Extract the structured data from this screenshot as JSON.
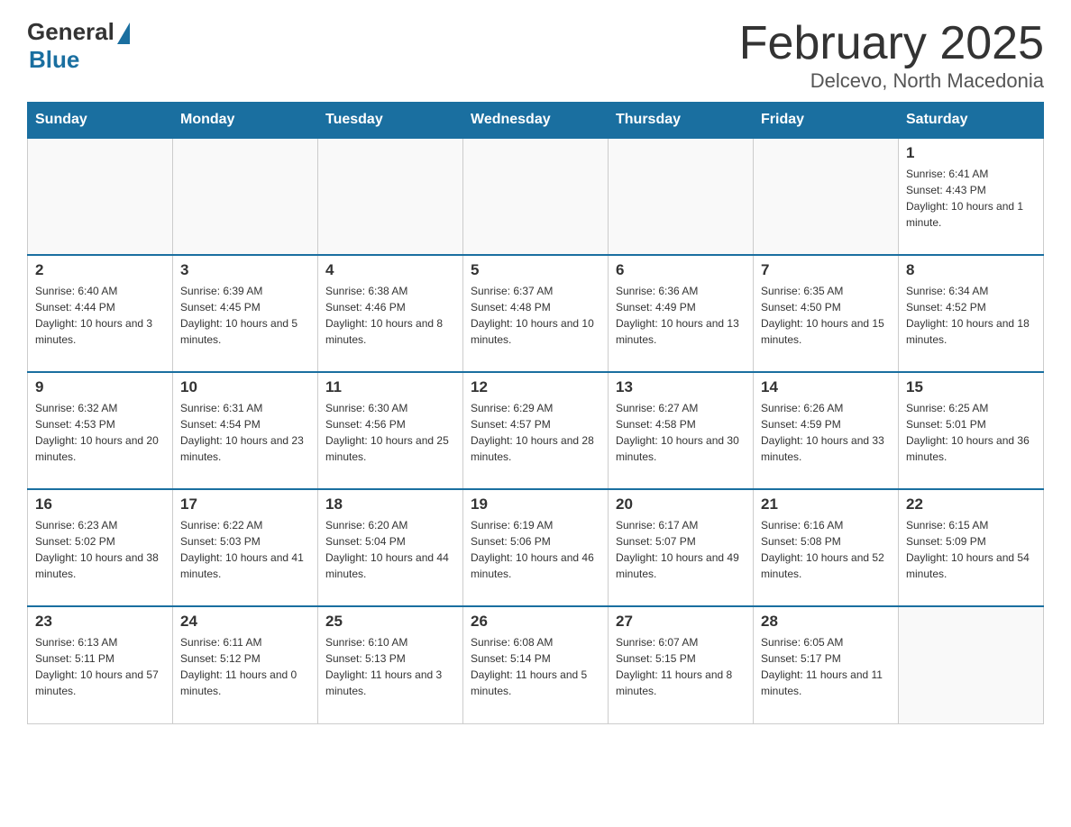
{
  "logo": {
    "general": "General",
    "blue": "Blue"
  },
  "header": {
    "month": "February 2025",
    "location": "Delcevo, North Macedonia"
  },
  "weekdays": [
    "Sunday",
    "Monday",
    "Tuesday",
    "Wednesday",
    "Thursday",
    "Friday",
    "Saturday"
  ],
  "weeks": [
    [
      {
        "day": "",
        "info": ""
      },
      {
        "day": "",
        "info": ""
      },
      {
        "day": "",
        "info": ""
      },
      {
        "day": "",
        "info": ""
      },
      {
        "day": "",
        "info": ""
      },
      {
        "day": "",
        "info": ""
      },
      {
        "day": "1",
        "info": "Sunrise: 6:41 AM\nSunset: 4:43 PM\nDaylight: 10 hours and 1 minute."
      }
    ],
    [
      {
        "day": "2",
        "info": "Sunrise: 6:40 AM\nSunset: 4:44 PM\nDaylight: 10 hours and 3 minutes."
      },
      {
        "day": "3",
        "info": "Sunrise: 6:39 AM\nSunset: 4:45 PM\nDaylight: 10 hours and 5 minutes."
      },
      {
        "day": "4",
        "info": "Sunrise: 6:38 AM\nSunset: 4:46 PM\nDaylight: 10 hours and 8 minutes."
      },
      {
        "day": "5",
        "info": "Sunrise: 6:37 AM\nSunset: 4:48 PM\nDaylight: 10 hours and 10 minutes."
      },
      {
        "day": "6",
        "info": "Sunrise: 6:36 AM\nSunset: 4:49 PM\nDaylight: 10 hours and 13 minutes."
      },
      {
        "day": "7",
        "info": "Sunrise: 6:35 AM\nSunset: 4:50 PM\nDaylight: 10 hours and 15 minutes."
      },
      {
        "day": "8",
        "info": "Sunrise: 6:34 AM\nSunset: 4:52 PM\nDaylight: 10 hours and 18 minutes."
      }
    ],
    [
      {
        "day": "9",
        "info": "Sunrise: 6:32 AM\nSunset: 4:53 PM\nDaylight: 10 hours and 20 minutes."
      },
      {
        "day": "10",
        "info": "Sunrise: 6:31 AM\nSunset: 4:54 PM\nDaylight: 10 hours and 23 minutes."
      },
      {
        "day": "11",
        "info": "Sunrise: 6:30 AM\nSunset: 4:56 PM\nDaylight: 10 hours and 25 minutes."
      },
      {
        "day": "12",
        "info": "Sunrise: 6:29 AM\nSunset: 4:57 PM\nDaylight: 10 hours and 28 minutes."
      },
      {
        "day": "13",
        "info": "Sunrise: 6:27 AM\nSunset: 4:58 PM\nDaylight: 10 hours and 30 minutes."
      },
      {
        "day": "14",
        "info": "Sunrise: 6:26 AM\nSunset: 4:59 PM\nDaylight: 10 hours and 33 minutes."
      },
      {
        "day": "15",
        "info": "Sunrise: 6:25 AM\nSunset: 5:01 PM\nDaylight: 10 hours and 36 minutes."
      }
    ],
    [
      {
        "day": "16",
        "info": "Sunrise: 6:23 AM\nSunset: 5:02 PM\nDaylight: 10 hours and 38 minutes."
      },
      {
        "day": "17",
        "info": "Sunrise: 6:22 AM\nSunset: 5:03 PM\nDaylight: 10 hours and 41 minutes."
      },
      {
        "day": "18",
        "info": "Sunrise: 6:20 AM\nSunset: 5:04 PM\nDaylight: 10 hours and 44 minutes."
      },
      {
        "day": "19",
        "info": "Sunrise: 6:19 AM\nSunset: 5:06 PM\nDaylight: 10 hours and 46 minutes."
      },
      {
        "day": "20",
        "info": "Sunrise: 6:17 AM\nSunset: 5:07 PM\nDaylight: 10 hours and 49 minutes."
      },
      {
        "day": "21",
        "info": "Sunrise: 6:16 AM\nSunset: 5:08 PM\nDaylight: 10 hours and 52 minutes."
      },
      {
        "day": "22",
        "info": "Sunrise: 6:15 AM\nSunset: 5:09 PM\nDaylight: 10 hours and 54 minutes."
      }
    ],
    [
      {
        "day": "23",
        "info": "Sunrise: 6:13 AM\nSunset: 5:11 PM\nDaylight: 10 hours and 57 minutes."
      },
      {
        "day": "24",
        "info": "Sunrise: 6:11 AM\nSunset: 5:12 PM\nDaylight: 11 hours and 0 minutes."
      },
      {
        "day": "25",
        "info": "Sunrise: 6:10 AM\nSunset: 5:13 PM\nDaylight: 11 hours and 3 minutes."
      },
      {
        "day": "26",
        "info": "Sunrise: 6:08 AM\nSunset: 5:14 PM\nDaylight: 11 hours and 5 minutes."
      },
      {
        "day": "27",
        "info": "Sunrise: 6:07 AM\nSunset: 5:15 PM\nDaylight: 11 hours and 8 minutes."
      },
      {
        "day": "28",
        "info": "Sunrise: 6:05 AM\nSunset: 5:17 PM\nDaylight: 11 hours and 11 minutes."
      },
      {
        "day": "",
        "info": ""
      }
    ]
  ]
}
